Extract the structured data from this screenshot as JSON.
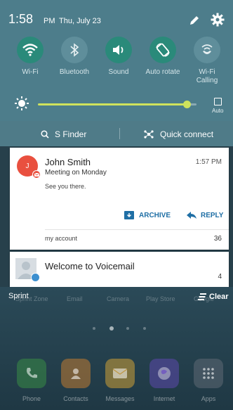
{
  "status": {
    "time": "1:58",
    "ampm": "PM",
    "date": "Thu, July 23"
  },
  "quick_settings": [
    {
      "label": "Wi-Fi",
      "icon": "wifi-icon",
      "on": true
    },
    {
      "label": "Bluetooth",
      "icon": "bluetooth-icon",
      "on": false
    },
    {
      "label": "Sound",
      "icon": "sound-icon",
      "on": true
    },
    {
      "label": "Auto rotate",
      "icon": "auto-rotate-icon",
      "on": true
    },
    {
      "label": "Wi-Fi Calling",
      "icon": "wifi-calling-icon",
      "on": false
    }
  ],
  "brightness": {
    "level": 0.94,
    "auto_label": "Auto"
  },
  "finder": {
    "sfinder_label": "S Finder",
    "quick_connect_label": "Quick connect"
  },
  "notifications": {
    "email": {
      "avatar_letter": "J",
      "sender": "John Smith",
      "time": "1:57 PM",
      "subject": "Meeting on Monday",
      "preview": "See you there.",
      "archive_label": "ARCHIVE",
      "reply_label": "REPLY",
      "account": "my account",
      "count": "36"
    },
    "voicemail": {
      "title": "Welcome to Voicemail",
      "count": "4"
    }
  },
  "carrier": "Sprint",
  "clear_label": "Clear",
  "home": {
    "ghost_apps": [
      "Sprint Zone",
      "Email",
      "Camera",
      "Play Store",
      "Google"
    ],
    "dock": [
      {
        "label": "Phone",
        "color": "#3f9d45"
      },
      {
        "label": "Contacts",
        "color": "#e58a2c"
      },
      {
        "label": "Messages",
        "color": "#f3b533"
      },
      {
        "label": "Internet",
        "color": "#6a4bc4"
      },
      {
        "label": "Apps",
        "color": "#5a6672"
      }
    ]
  },
  "colors": {
    "panel": "#4d7d8b",
    "accent_on": "#2a8a7a",
    "slider": "#cfe25c",
    "link": "#1f6fa5",
    "email_avatar": "#e9503f"
  }
}
